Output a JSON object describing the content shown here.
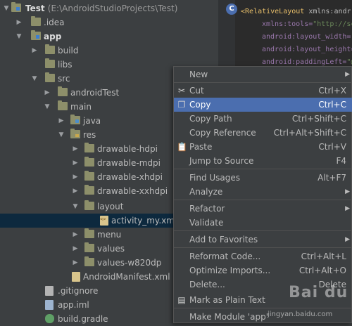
{
  "tree": {
    "root_name": "Test",
    "root_path": "(E:\\AndroidStudioProjects\\Test)",
    "items": [
      {
        "label": ".idea"
      },
      {
        "label": "app"
      },
      {
        "label": "build"
      },
      {
        "label": "libs"
      },
      {
        "label": "src"
      },
      {
        "label": "androidTest"
      },
      {
        "label": "main"
      },
      {
        "label": "java"
      },
      {
        "label": "res"
      },
      {
        "label": "drawable-hdpi"
      },
      {
        "label": "drawable-mdpi"
      },
      {
        "label": "drawable-xhdpi"
      },
      {
        "label": "drawable-xxhdpi"
      },
      {
        "label": "layout"
      },
      {
        "label": "activity_my.xml"
      },
      {
        "label": "menu"
      },
      {
        "label": "values"
      },
      {
        "label": "values-w820dp"
      },
      {
        "label": "AndroidManifest.xml"
      },
      {
        "label": ".gitignore"
      },
      {
        "label": "app.iml"
      },
      {
        "label": "build.gradle"
      }
    ]
  },
  "editor": {
    "badge": "C",
    "lines": [
      {
        "tag": "<RelativeLayout",
        "attr": " xmlns:andr"
      },
      {
        "attr": "xmlns:tools=",
        "str": "\"http://sc"
      },
      {
        "attr": "android:layout_width=",
        "str": "\""
      },
      {
        "attr": "android:layout_height=",
        "str": ""
      },
      {
        "attr": "android:paddingLeft=",
        "str": "\"@"
      }
    ]
  },
  "menu": {
    "items": [
      {
        "label": "New",
        "shortcut": "",
        "submenu": true
      },
      {
        "label": "Cut",
        "shortcut": "Ctrl+X",
        "icon": "scissors-icon"
      },
      {
        "label": "Copy",
        "shortcut": "Ctrl+C",
        "icon": "copy-icon"
      },
      {
        "label": "Copy Path",
        "shortcut": "Ctrl+Shift+C"
      },
      {
        "label": "Copy Reference",
        "shortcut": "Ctrl+Alt+Shift+C"
      },
      {
        "label": "Paste",
        "shortcut": "Ctrl+V",
        "icon": "paste-icon"
      },
      {
        "label": "Jump to Source",
        "shortcut": "F4"
      },
      {
        "label": "Find Usages",
        "shortcut": "Alt+F7"
      },
      {
        "label": "Analyze",
        "shortcut": "",
        "submenu": true
      },
      {
        "label": "Refactor",
        "shortcut": "",
        "submenu": true
      },
      {
        "label": "Validate",
        "shortcut": ""
      },
      {
        "label": "Add to Favorites",
        "shortcut": "",
        "submenu": true
      },
      {
        "label": "Reformat Code...",
        "shortcut": "Ctrl+Alt+L"
      },
      {
        "label": "Optimize Imports...",
        "shortcut": "Ctrl+Alt+O"
      },
      {
        "label": "Delete...",
        "shortcut": "Delete"
      },
      {
        "label": "Mark as Plain Text",
        "shortcut": "",
        "icon": "plain-text-icon"
      },
      {
        "label": "Make Module 'app'",
        "shortcut": ""
      }
    ],
    "highlighted": "Copy"
  },
  "watermark": {
    "logo": "Bai du",
    "url": "jingyan.baidu.com"
  },
  "colors": {
    "highlight": "#4b6eaf",
    "selected_row": "#0d293e",
    "background": "#3c3f41"
  }
}
